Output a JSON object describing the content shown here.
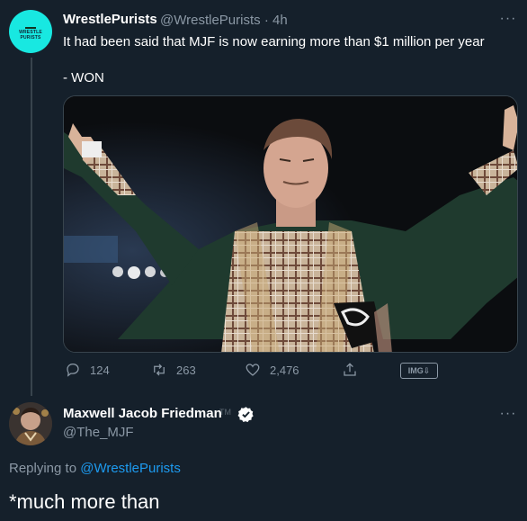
{
  "tweet": {
    "author_name": "WrestlePurists",
    "author_handle": "@WrestlePurists",
    "time": "4h",
    "avatar_text": "WRESTLE PURISTS",
    "text": "It had been said that MJF is now earning more than $1 million per year\n\n- WON",
    "more_icon": "more-horizontal-icon",
    "actions": {
      "replies": "124",
      "retweets": "263",
      "likes": "2,476",
      "img_label": "IMG⇩"
    }
  },
  "reply": {
    "author_name": "Maxwell Jacob Friedman",
    "tm": "TM",
    "author_handle": "@The_MJF",
    "replying_prefix": "Replying to",
    "replying_to": "@WrestlePurists",
    "text": "*much more than",
    "more_icon": "more-horizontal-icon"
  },
  "colors": {
    "background": "#15202b",
    "accent": "#1d9bf0",
    "muted": "#8b98a5",
    "avatar_bg": "#18e8e1"
  }
}
